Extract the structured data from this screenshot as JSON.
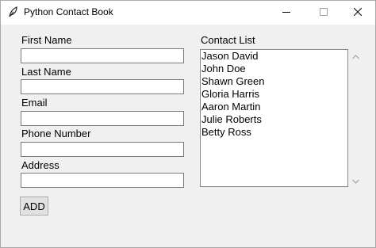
{
  "window": {
    "title": "Python Contact Book",
    "icon": "feather-icon",
    "controls": [
      "minimize",
      "maximize",
      "close"
    ]
  },
  "form": {
    "first_name": {
      "label": "First Name",
      "value": ""
    },
    "last_name": {
      "label": "Last Name",
      "value": ""
    },
    "email": {
      "label": "Email",
      "value": ""
    },
    "phone": {
      "label": "Phone Number",
      "value": ""
    },
    "address": {
      "label": "Address",
      "value": ""
    }
  },
  "contacts": {
    "label": "Contact List",
    "items": [
      "Jason David",
      "John Doe",
      "Shawn Green",
      "Gloria Harris",
      "Aaron Martin",
      "Julie Roberts",
      "Betty Ross"
    ]
  },
  "actions": {
    "add_label": "ADD"
  }
}
